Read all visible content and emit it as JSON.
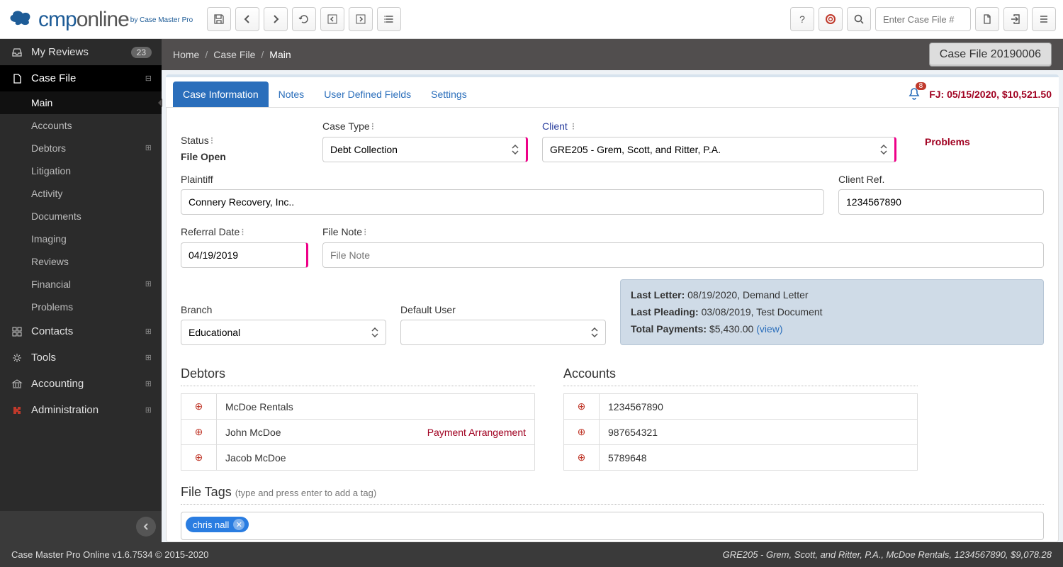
{
  "topbar": {
    "logo_main": "cmp",
    "logo_online": "online",
    "logo_sub": "by Case Master Pro",
    "search_placeholder": "Enter Case File #"
  },
  "sidebar": {
    "reviews": {
      "label": "My Reviews",
      "badge": "23"
    },
    "casefile": {
      "label": "Case File"
    },
    "casefile_sub": [
      {
        "label": "Main",
        "active": true
      },
      {
        "label": "Accounts"
      },
      {
        "label": "Debtors",
        "expand": true
      },
      {
        "label": "Litigation"
      },
      {
        "label": "Activity"
      },
      {
        "label": "Documents"
      },
      {
        "label": "Imaging"
      },
      {
        "label": "Reviews"
      },
      {
        "label": "Financial",
        "expand": true
      },
      {
        "label": "Problems"
      }
    ],
    "contacts": "Contacts",
    "tools": "Tools",
    "accounting": "Accounting",
    "administration": "Administration"
  },
  "breadcrumb": {
    "home": "Home",
    "casefile": "Case File",
    "main": "Main"
  },
  "case_badge": "Case File 20190006",
  "tabs": {
    "caseinfo": "Case Information",
    "notes": "Notes",
    "udf": "User Defined Fields",
    "settings": "Settings"
  },
  "bell_count": "8",
  "fj": "FJ: 05/15/2020, $10,521.50",
  "form": {
    "status_label": "Status",
    "status_value": "File Open",
    "casetype_label": "Case Type",
    "casetype_value": "Debt Collection",
    "client_label": "Client",
    "client_value": "GRE205 - Grem, Scott, and Ritter, P.A.",
    "problems_label": "Problems",
    "plaintiff_label": "Plaintiff",
    "plaintiff_value": "Connery Recovery, Inc..",
    "clientref_label": "Client Ref.",
    "clientref_value": "1234567890",
    "referral_label": "Referral Date",
    "referral_value": "04/19/2019",
    "filenote_label": "File Note",
    "filenote_placeholder": "File Note",
    "branch_label": "Branch",
    "branch_value": "Educational",
    "defuser_label": "Default User"
  },
  "infobox": {
    "lastletter_k": "Last Letter:",
    "lastletter_v": "08/19/2020, Demand Letter",
    "lastpleading_k": "Last Pleading:",
    "lastpleading_v": "03/08/2019, Test Document",
    "totalpay_k": "Total Payments:",
    "totalpay_v": "$5,430.00",
    "view": "(view)"
  },
  "debtors": {
    "title": "Debtors",
    "rows": [
      {
        "name": "McDoe Rentals"
      },
      {
        "name": "John McDoe",
        "tag": "Payment Arrangement"
      },
      {
        "name": "Jacob McDoe"
      }
    ]
  },
  "accounts": {
    "title": "Accounts",
    "rows": [
      {
        "num": "1234567890"
      },
      {
        "num": "987654321"
      },
      {
        "num": "5789648"
      }
    ]
  },
  "filetags": {
    "title": "File Tags",
    "hint": "(type and press enter to add a tag)",
    "tag": "chris nall"
  },
  "footer": {
    "left": "Case Master Pro Online v1.6.7534 © 2015-2020",
    "right": "GRE205 - Grem, Scott, and Ritter, P.A., McDoe Rentals, 1234567890, $9,078.28"
  }
}
